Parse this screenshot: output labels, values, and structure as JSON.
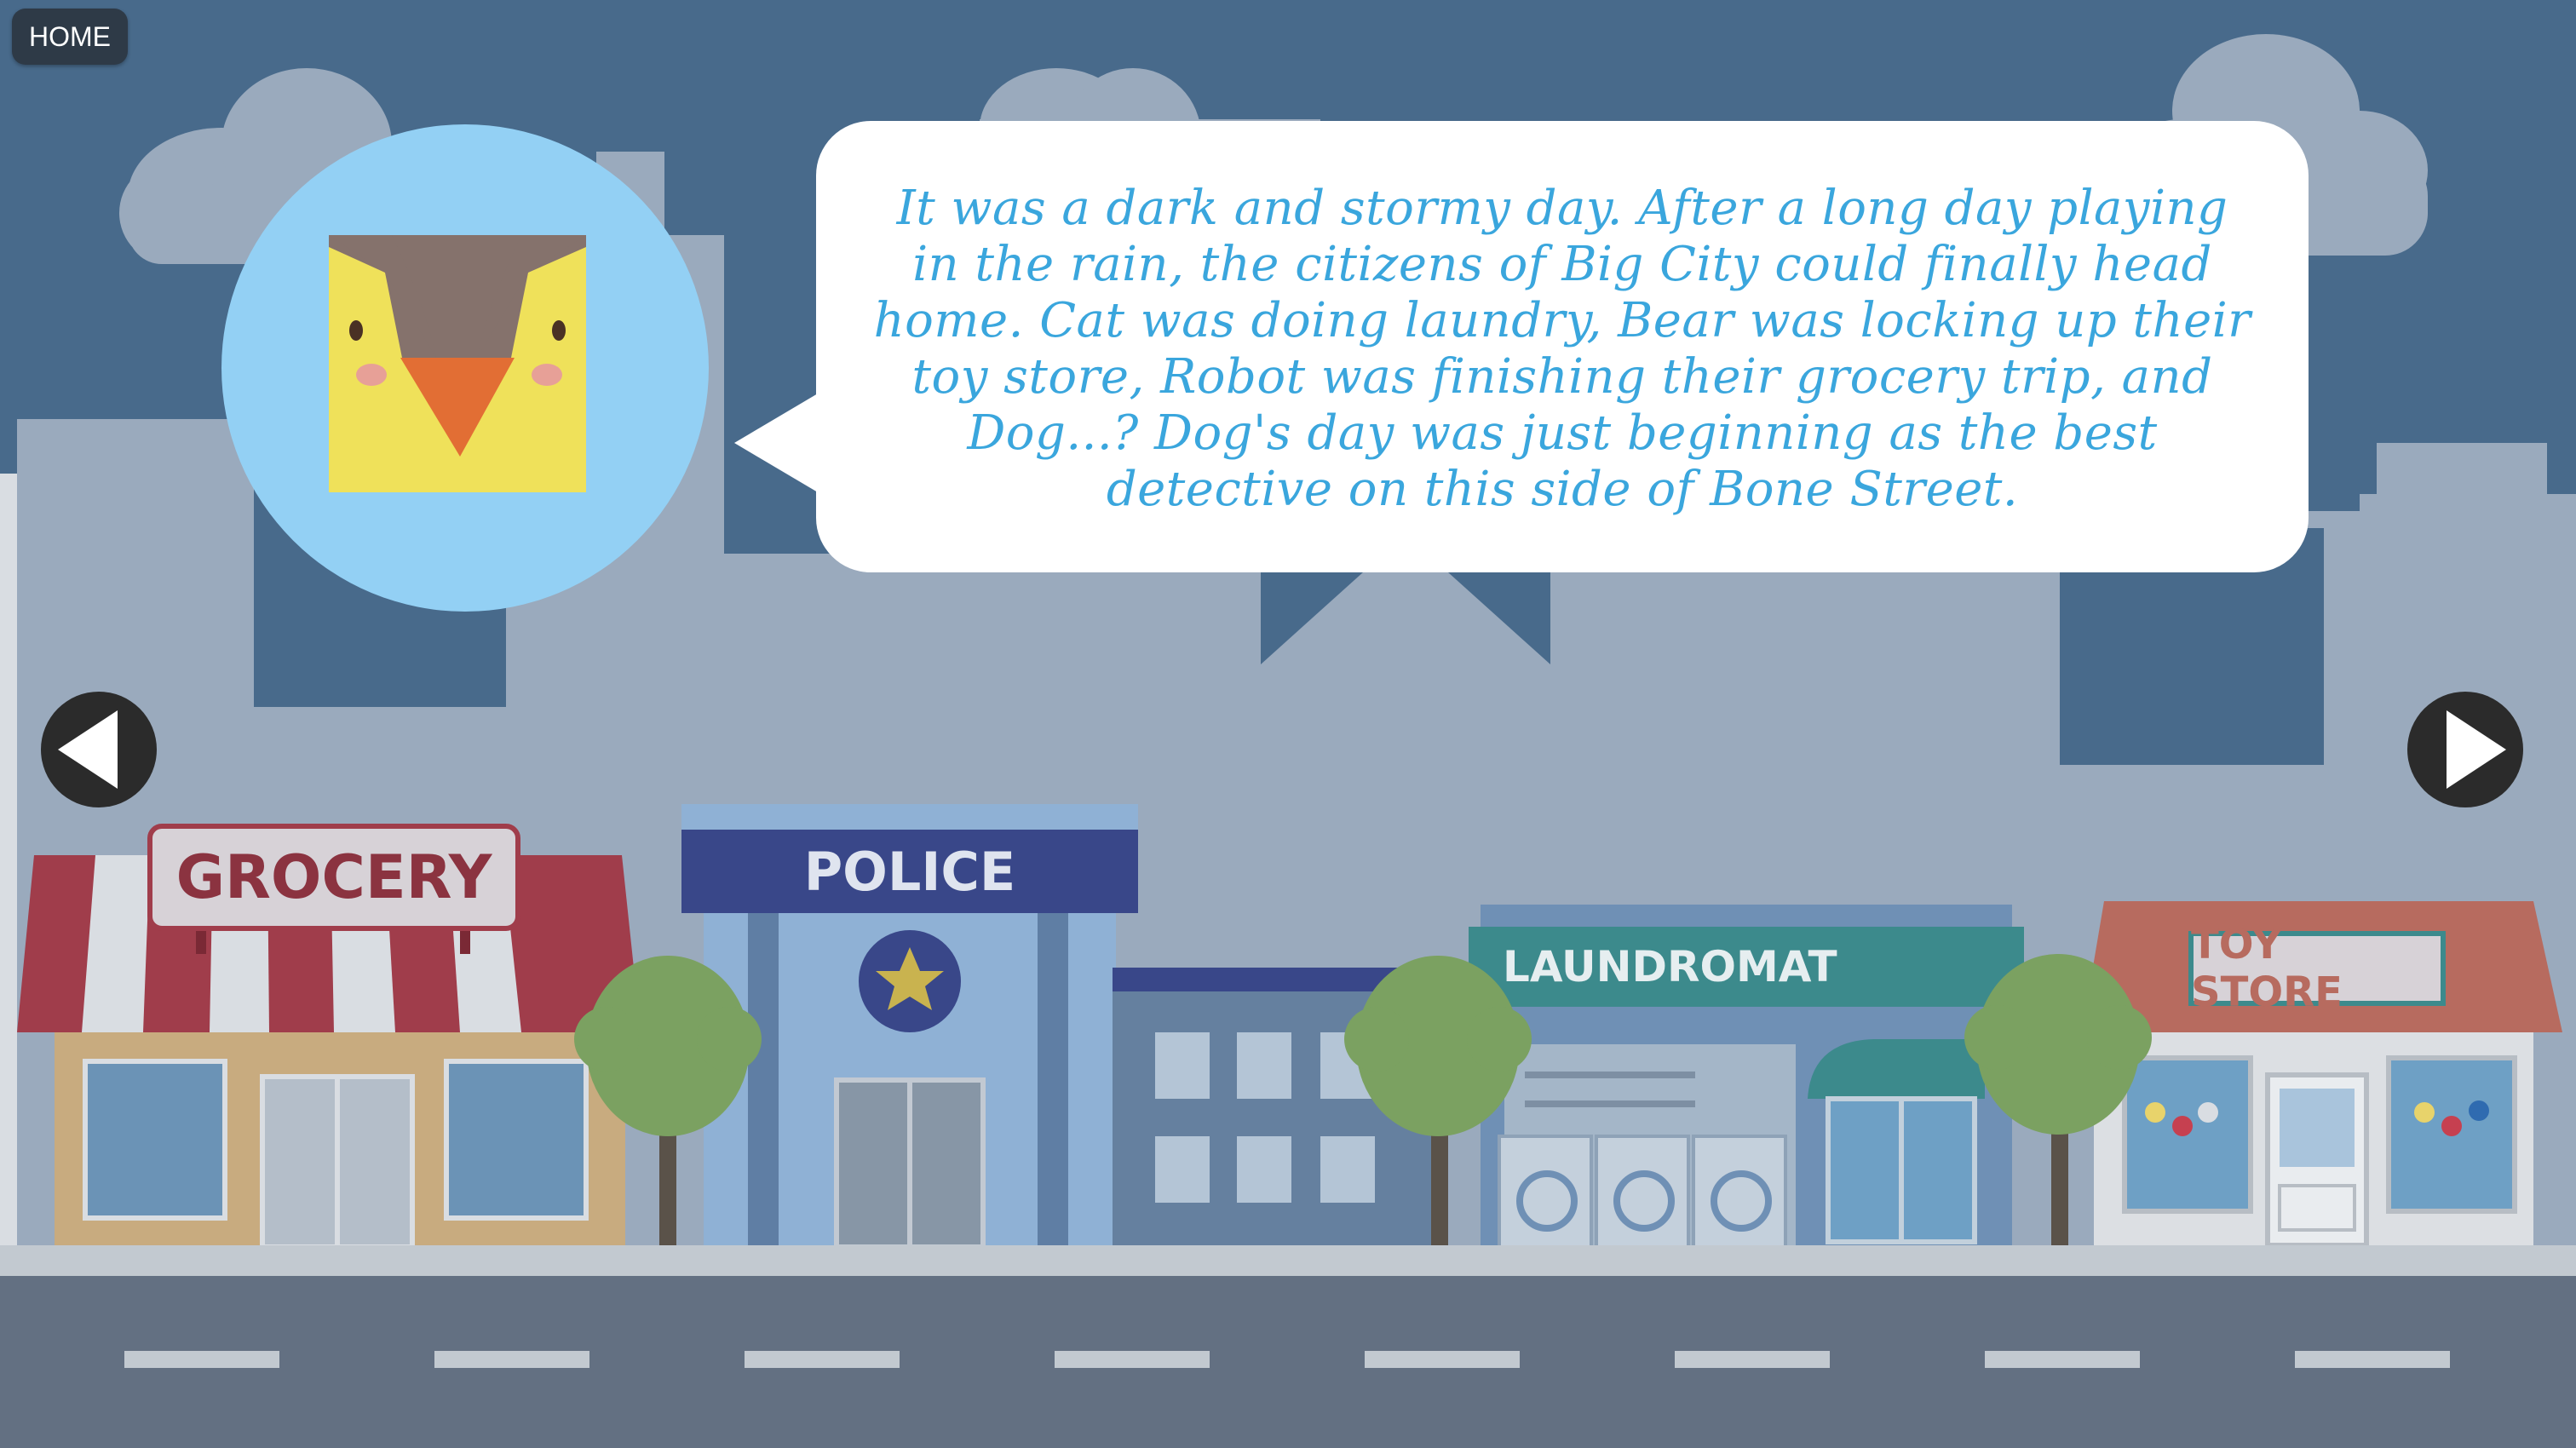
{
  "nav": {
    "home_label": "HOME"
  },
  "narrator": {
    "avatar": "bird-narrator-avatar"
  },
  "story": {
    "text": "It was a dark and stormy day. After a long day playing in the rain, the citizens of Big City could finally head home. Cat was doing laundry, Bear was locking up their toy store, Robot was finishing their grocery trip, and Dog...? Dog's day was just beginning as the best detective on this side of Bone Street."
  },
  "controls": {
    "previous_icon": "left-arrow-icon",
    "next_icon": "right-arrow-icon"
  },
  "buildings": {
    "grocery_sign": "GROCERY",
    "police_sign": "POLICE",
    "laundromat_sign": "LAUNDROMAT",
    "toy_store_sign": "TOY STORE"
  },
  "colors": {
    "sky": "#486a8b",
    "bubble_text": "#3aa6dd",
    "avatar_circle": "#93d0f4"
  }
}
